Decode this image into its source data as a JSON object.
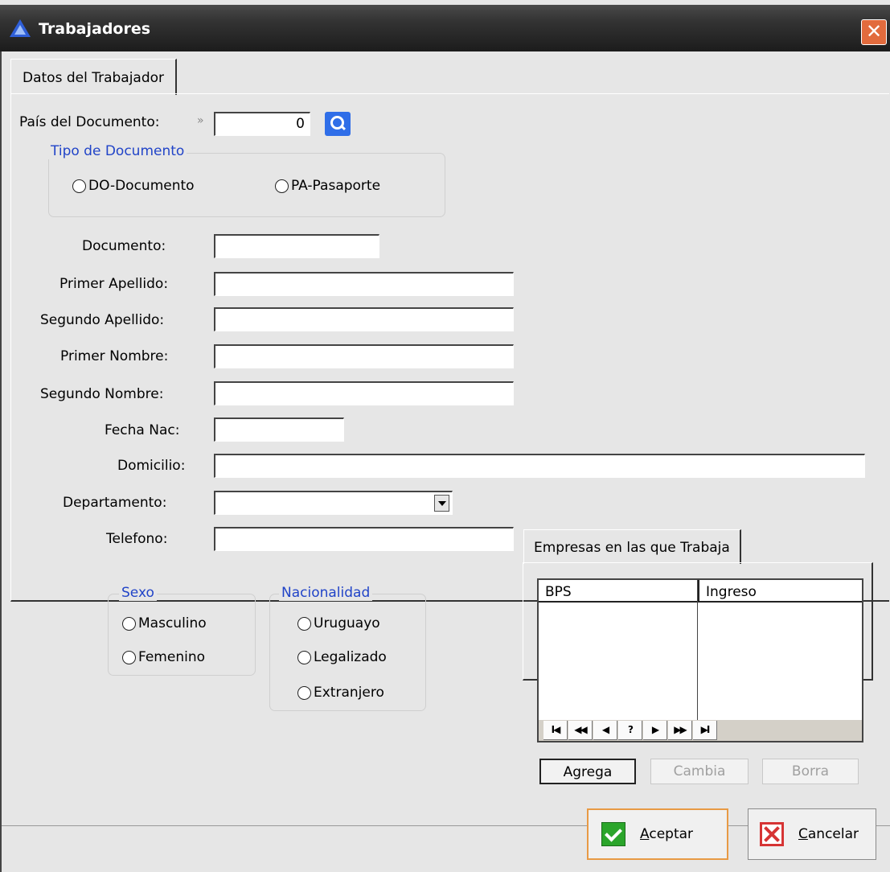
{
  "window": {
    "title": "Trabajadores",
    "close_glyph": "✕"
  },
  "tabs": {
    "main": "Datos del Trabajador",
    "empresas": "Empresas en las que Trabaja"
  },
  "form": {
    "pais_label": "País del Documento:",
    "pais_marker": "»",
    "pais_value": "0",
    "tipo_doc": {
      "legend": "Tipo de Documento",
      "options": [
        "DO-Documento",
        "PA-Pasaporte"
      ]
    },
    "documento_label": "Documento:",
    "primer_apellido_label": "Primer Apellido:",
    "segundo_apellido_label": "Segundo Apellido:",
    "primer_nombre_label": "Primer Nombre:",
    "segundo_nombre_label": "Segundo Nombre:",
    "fecha_nac_label": "Fecha Nac:",
    "domicilio_label": "Domicilio:",
    "departamento_label": "Departamento:",
    "telefono_label": "Telefono:",
    "sexo": {
      "legend": "Sexo",
      "options": [
        "Masculino",
        "Femenino"
      ]
    },
    "nacionalidad": {
      "legend": "Nacionalidad",
      "options": [
        "Uruguayo",
        "Legalizado",
        "Extranjero"
      ]
    }
  },
  "empresas": {
    "columns": [
      "BPS",
      "Ingreso"
    ],
    "nav": [
      "I◀",
      "◀◀",
      "◀",
      "?",
      "▶",
      "▶▶",
      "▶I"
    ],
    "buttons": {
      "agrega": "Agrega",
      "cambia": "Cambia",
      "borra": "Borra"
    }
  },
  "footer": {
    "aceptar_first": "A",
    "aceptar_rest": "ceptar",
    "cancelar_first": "C",
    "cancelar_rest": "ancelar"
  },
  "icons": {
    "app": "triangle-logo-icon",
    "search": "magnifier-icon",
    "accept": "check-icon",
    "cancel": "x-icon"
  }
}
